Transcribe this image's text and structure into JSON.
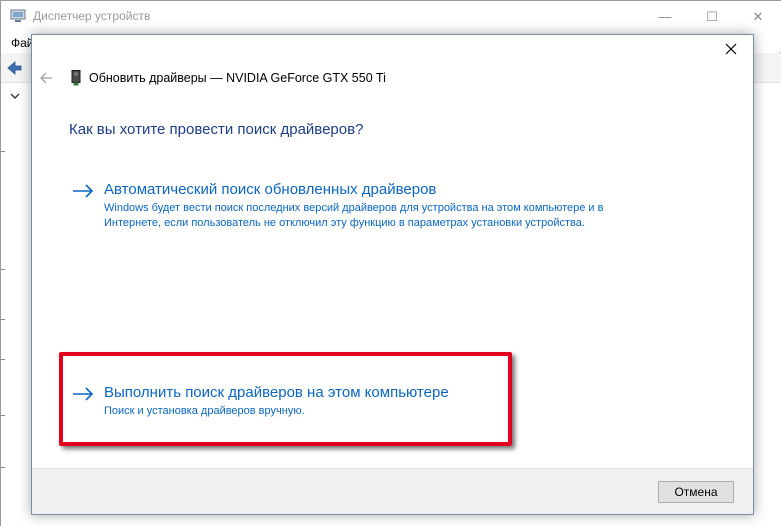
{
  "background_window": {
    "title": "Диспетчер устройств",
    "menu_file": "Фай",
    "controls": {
      "minimize": "—",
      "maximize": "☐",
      "close": "✕"
    }
  },
  "dialog": {
    "title": "Обновить драйверы — NVIDIA GeForce GTX 550 Ti",
    "heading": "Как вы хотите провести поиск драйверов?",
    "options": [
      {
        "title": "Автоматический поиск обновленных драйверов",
        "desc_line1": "Windows будет вести поиск последних версий драйверов для устройства на этом компьютере и в",
        "desc_line2": "Интернете, если пользователь не отключил эту функцию в параметрах установки устройства."
      },
      {
        "title": "Выполнить поиск драйверов на этом компьютере",
        "desc_line1": "Поиск и установка драйверов вручную."
      }
    ],
    "cancel_label": "Отмена"
  },
  "colors": {
    "link": "#0a67c4",
    "heading": "#1c3c8c",
    "highlight": "#e3001b"
  }
}
